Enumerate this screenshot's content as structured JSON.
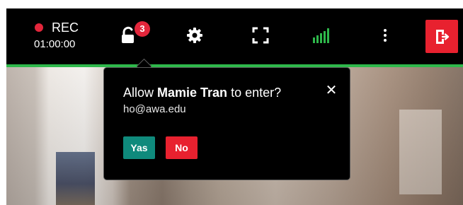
{
  "toolbar": {
    "recording": {
      "label": "REC",
      "elapsed": "01:00:00",
      "dot_color": "#e3263b"
    },
    "lobby": {
      "icon": "unlocked-padlock-icon",
      "pending_count": "3"
    },
    "settings": {
      "icon": "gear-icon"
    },
    "fullscreen": {
      "icon": "fullscreen-icon"
    },
    "connection": {
      "icon": "signal-strength-icon",
      "level": 1.0,
      "color": "#2eb84b"
    },
    "more": {
      "icon": "more-vertical-icon"
    },
    "leave": {
      "icon": "leave-door-icon",
      "color": "#e8212f"
    }
  },
  "admit_prompt": {
    "prefix": "Allow ",
    "name": "Mamie Tran",
    "suffix": " to enter?",
    "email": "ho@awa.edu",
    "close_icon": "close-icon",
    "close_glyph": "✕",
    "accept_label": "Yas",
    "decline_label": "No",
    "accept_color": "#0f8a7c",
    "decline_color": "#e8212f"
  }
}
